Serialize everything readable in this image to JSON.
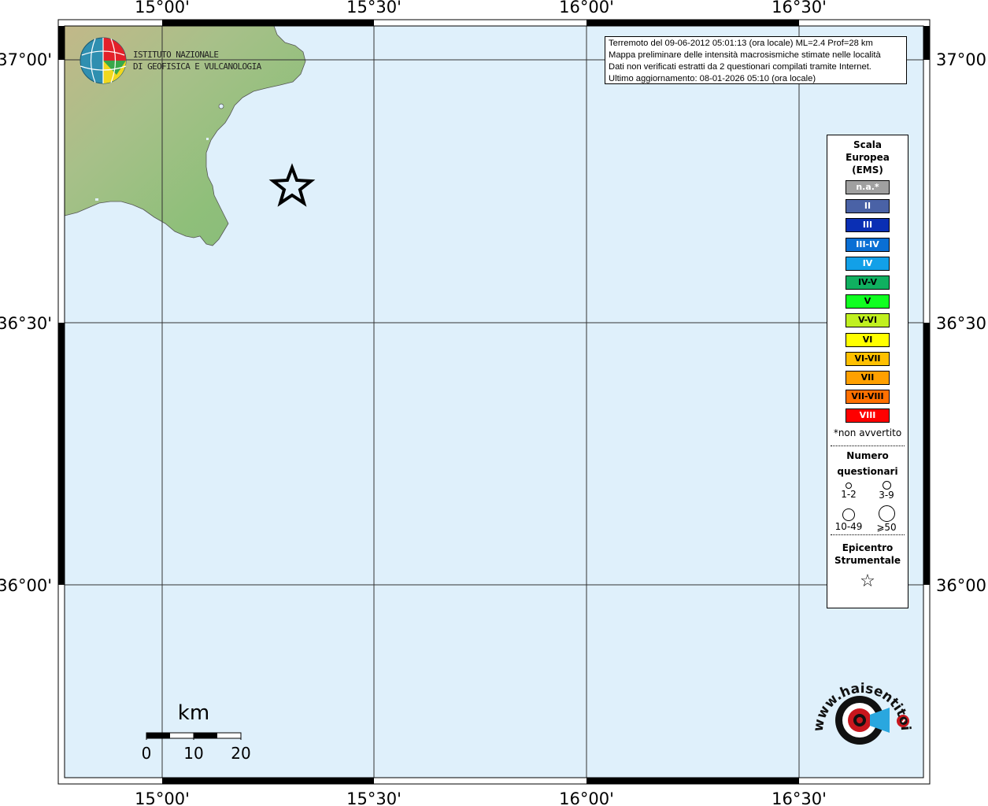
{
  "map": {
    "lon_labels": [
      "15°00'",
      "15°30'",
      "16°00'",
      "16°30'"
    ],
    "lat_labels": [
      "37°00'",
      "36°30'",
      "36°00'"
    ],
    "extent": {
      "lon_min": 14.87,
      "lon_max": 16.81,
      "lat_min": 35.68,
      "lat_max": 37.07
    },
    "epicenter": {
      "lon": 15.3,
      "lat": 36.77
    },
    "colors": {
      "sea": "#dff0fb",
      "land_green": "#8fbf7a",
      "land_tan": "#c2b889"
    }
  },
  "logo": {
    "line1": "ISTITUTO NAZIONALE",
    "line2": "DI GEOFISICA E VULCANOLOGIA",
    "icon": "ingv-globe-logo"
  },
  "info": {
    "line1": "Terremoto del 09-06-2012 05:01:13 (ora locale) ML=2.4 Prof=28 km",
    "line2": "Mappa preliminare delle intensità macrosismiche stimate nelle località",
    "line3": "Dati non verificati estratti da 2 questionari compilati tramite Internet.",
    "line4": "Ultimo aggiornamento: 08-01-2026 05:10 (ora locale)"
  },
  "legend": {
    "title1": "Scala",
    "title2": "Europea",
    "title3": "(EMS)",
    "intensity": [
      {
        "label": "n.a.*",
        "color": "#a0a0a0",
        "text_color": "#ffffff"
      },
      {
        "label": "II",
        "color": "#4a62a6",
        "text_color": "#ffffff"
      },
      {
        "label": "III",
        "color": "#0a2fb4",
        "text_color": "#ffffff"
      },
      {
        "label": "III-IV",
        "color": "#0a6fd4",
        "text_color": "#ffffff"
      },
      {
        "label": "IV",
        "color": "#12a0e8",
        "text_color": "#ffffff"
      },
      {
        "label": "IV-V",
        "color": "#10b060",
        "text_color": "#000000"
      },
      {
        "label": "V",
        "color": "#10ff20",
        "text_color": "#000000"
      },
      {
        "label": "V-VI",
        "color": "#c0f020",
        "text_color": "#000000"
      },
      {
        "label": "VI",
        "color": "#ffff00",
        "text_color": "#000000"
      },
      {
        "label": "VI-VII",
        "color": "#ffc000",
        "text_color": "#000000"
      },
      {
        "label": "VII",
        "color": "#ffa000",
        "text_color": "#000000"
      },
      {
        "label": "VII-VIII",
        "color": "#ff7000",
        "text_color": "#000000"
      },
      {
        "label": "VIII",
        "color": "#ff0000",
        "text_color": "#ffffff"
      }
    ],
    "note": "*non avvertito",
    "questionari_title1": "Numero",
    "questionari_title2": "questionari",
    "q_labels": [
      "1-2",
      "3-9",
      "10-49",
      "⩾50"
    ],
    "epicentro1": "Epicentro",
    "epicentro2": "Strumentale",
    "epicentro_icon": "☆"
  },
  "scale": {
    "unit": "km",
    "ticks": [
      "0",
      "10",
      "20"
    ]
  },
  "hsit_logo": {
    "text": "www.haisentitoilterremoto.it",
    "icon": "haisentito-target-logo"
  }
}
